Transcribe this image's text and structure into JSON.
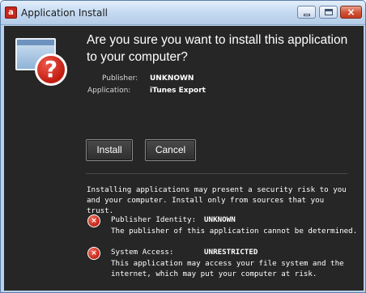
{
  "window": {
    "title": "Application Install",
    "app_icon_glyph": "a",
    "controls": {
      "minimize": "",
      "maximize": "",
      "close": "×"
    }
  },
  "dialog": {
    "question": "Are you sure you want to install this application to your computer?",
    "publisher_label": "Publisher:",
    "publisher_value": "UNKNOWN",
    "application_label": "Application:",
    "application_value": "iTunes Export",
    "install_button": "Install",
    "cancel_button": "Cancel",
    "warning_text": "Installing applications may present a security risk to you and your computer. Install only from sources that you trust.",
    "risks": [
      {
        "icon": "error-icon",
        "label": "Publisher Identity:",
        "value": "UNKNOWN",
        "description": "The publisher of this application cannot be determined."
      },
      {
        "icon": "error-icon",
        "label": "System Access:",
        "value": "UNRESTRICTED",
        "description": "This application may access your file system and the internet, which may put your computer at risk."
      }
    ]
  },
  "colors": {
    "background": "#262626",
    "titlebar": "#c7dcf3",
    "alert_red": "#c42618"
  }
}
